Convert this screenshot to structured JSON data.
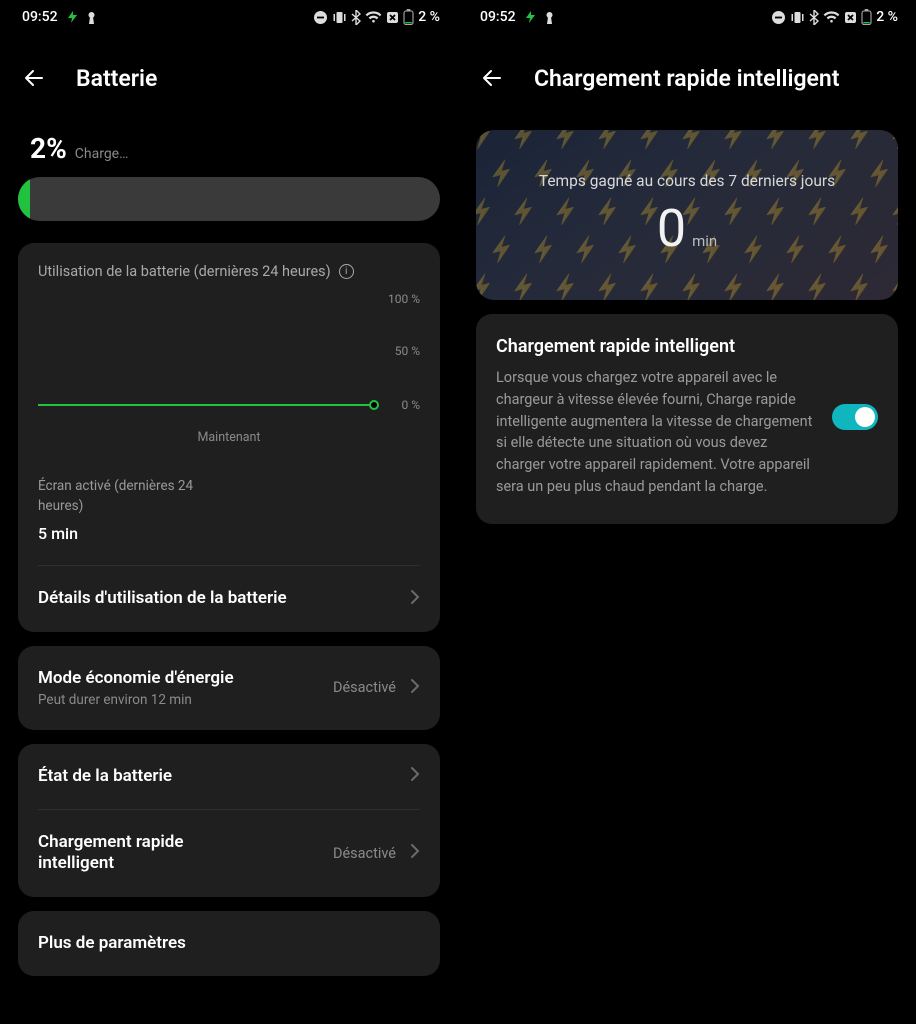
{
  "status": {
    "time": "09:52",
    "battery_text": "2 %"
  },
  "left": {
    "title": "Batterie",
    "pct": "2%",
    "pct_sub": "Charge…",
    "usage_title": "Utilisation de la batterie (dernières 24 heures)",
    "y100": "100 %",
    "y50": "50 %",
    "y0": "0 %",
    "now": "Maintenant",
    "screen_on_label": "Écran activé (dernières 24 heures)",
    "screen_on_value": "5 min",
    "details": "Détails d'utilisation de la batterie",
    "eco_title": "Mode économie d'énergie",
    "eco_sub": "Peut durer environ 12 min",
    "eco_status": "Désactivé",
    "health": "État de la batterie",
    "smart_title": "Chargement rapide intelligent",
    "smart_status": "Désactivé",
    "more": "Plus de paramètres"
  },
  "right": {
    "title": "Chargement rapide intelligent",
    "time_saved_label": "Temps gagné au cours des 7 derniers jours",
    "time_saved_value": "0",
    "time_saved_unit": "min",
    "toggle_title": "Chargement rapide intelligent",
    "toggle_desc": "Lorsque vous chargez votre appareil avec le chargeur à vitesse élevée fourni, Charge rapide intelligente augmentera la vitesse de chargement si elle détecte une situation où vous devez charger votre appareil rapidement. Votre appareil sera un peu plus chaud pendant la charge.",
    "toggle_on": true
  },
  "chart_data": {
    "type": "line",
    "title": "Utilisation de la batterie (dernières 24 heures)",
    "xlabel": "",
    "ylabel": "%",
    "ylim": [
      0,
      100
    ],
    "x": [
      0,
      24
    ],
    "values": [
      2,
      2
    ],
    "x_now_label": "Maintenant"
  }
}
